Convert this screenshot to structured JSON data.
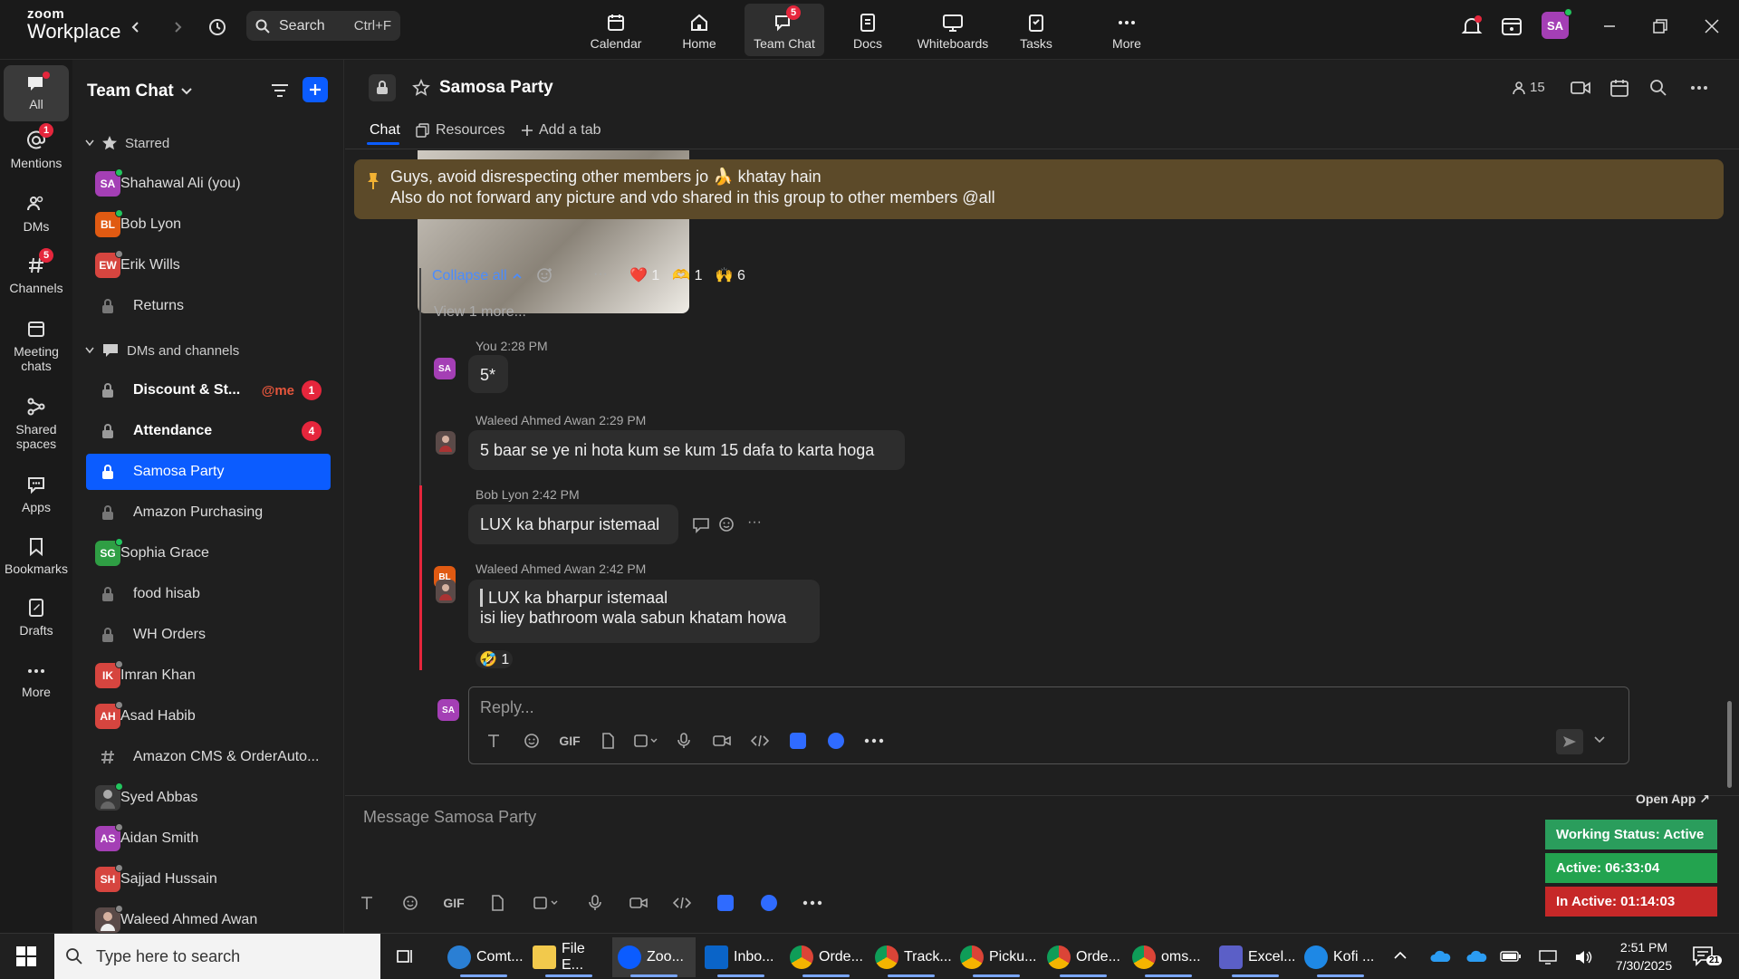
{
  "app": {
    "logo_top": "zoom",
    "logo_bottom": "Workplace"
  },
  "topbar": {
    "search_label": "Search",
    "search_shortcut": "Ctrl+F",
    "nav": [
      {
        "label": "Calendar"
      },
      {
        "label": "Home"
      },
      {
        "label": "Team Chat",
        "badge": "5"
      },
      {
        "label": "Docs"
      },
      {
        "label": "Whiteboards"
      },
      {
        "label": "Tasks"
      },
      {
        "label": "More"
      }
    ],
    "avatar": "SA"
  },
  "rail": [
    {
      "label": "All"
    },
    {
      "label": "Mentions",
      "badge": "1"
    },
    {
      "label": "DMs"
    },
    {
      "label": "Channels",
      "badge": "5"
    },
    {
      "label": "Meeting chats"
    },
    {
      "label": "Shared spaces"
    },
    {
      "label": "Apps"
    },
    {
      "label": "Bookmarks"
    },
    {
      "label": "Drafts"
    },
    {
      "label": "More"
    }
  ],
  "sidebar": {
    "title": "Team Chat",
    "starred_label": "Starred",
    "starred": [
      {
        "initials": "SA",
        "name": "Shahawal Ali (you)",
        "color": "#a43fb5"
      },
      {
        "initials": "BL",
        "name": "Bob Lyon",
        "color": "#e05a12"
      },
      {
        "initials": "EW",
        "name": "Erik Wills",
        "color": "#d6453f"
      },
      {
        "name": "Returns"
      }
    ],
    "dms_label": "DMs and channels",
    "channels": [
      {
        "name": "Discount & St...",
        "mention": "@me",
        "count": "1"
      },
      {
        "name": "Attendance",
        "count": "4"
      },
      {
        "name": "Samosa Party"
      },
      {
        "name": "Amazon Purchasing"
      },
      {
        "initials": "SG",
        "name": "Sophia Grace",
        "color": "#2f9e44"
      },
      {
        "name": "food hisab"
      },
      {
        "name": "WH Orders"
      },
      {
        "initials": "IK",
        "name": "Imran Khan",
        "color": "#d6453f"
      },
      {
        "initials": "AH",
        "name": "Asad Habib",
        "color": "#d6453f"
      },
      {
        "name": "Amazon CMS & OrderAuto..."
      },
      {
        "name": "Syed Abbas"
      },
      {
        "initials": "AS",
        "name": "Aidan Smith",
        "color": "#a43fb5"
      },
      {
        "initials": "SH",
        "name": "Sajjad Hussain",
        "color": "#d6453f"
      },
      {
        "name": "Waleed Ahmed Awan"
      }
    ]
  },
  "channel": {
    "name": "Samosa Party",
    "members": "15",
    "tabs": {
      "chat": "Chat",
      "resources": "Resources",
      "add": "Add a tab"
    },
    "pinned_line1": "Guys, avoid disrespecting other members jo 🍌 khatay hain",
    "pinned_line2": "Also do not forward any picture and vdo shared in this group to other members @all"
  },
  "thread": {
    "collapse": "Collapse all",
    "reactions": [
      {
        "emoji": "❤️",
        "count": "1"
      },
      {
        "emoji": "🫶",
        "count": "1"
      },
      {
        "emoji": "🙌",
        "count": "6"
      }
    ],
    "view_more": "View 1 more...",
    "messages": [
      {
        "author": "You",
        "time": "2:28 PM",
        "avatar": "SA",
        "text": "5*"
      },
      {
        "author": "Waleed Ahmed Awan",
        "time": "2:29 PM",
        "text": "5 baar se ye ni hota kum se kum 15 dafa to karta hoga"
      },
      {
        "author": "Bob Lyon",
        "time": "2:42 PM",
        "avatar": "BL",
        "text": "LUX ka bharpur istemaal"
      },
      {
        "author": "Waleed Ahmed Awan",
        "time": "2:42 PM",
        "quote": "LUX ka bharpur istemaal",
        "text": "isi liey bathroom wala sabun khatam howa",
        "reaction_emoji": "🤣",
        "reaction_count": "1"
      }
    ],
    "reply_placeholder": "Reply...",
    "reply_avatar": "SA"
  },
  "composer": {
    "placeholder": "Message Samosa Party",
    "gif": "GIF"
  },
  "widget": {
    "open_app": "Open App ↗",
    "working_status": "Working Status: Active",
    "active": "Active: 06:33:04",
    "inactive": "In Active: 01:14:03",
    "colors": {
      "working": "#1f9d55",
      "active": "#1e9f4a",
      "inactive": "#c62828"
    }
  },
  "taskbar": {
    "search_placeholder": "Type here to search",
    "apps": [
      {
        "label": "Comt...",
        "color": "#2a7fd4"
      },
      {
        "label": "File E...",
        "color": "#f2c94c"
      },
      {
        "label": "Zoo...",
        "color": "#0b5cff"
      },
      {
        "label": "Inbo...",
        "color": "#0a64c8"
      },
      {
        "label": "Orde...",
        "color": "#db4437"
      },
      {
        "label": "Track...",
        "color": "#db4437"
      },
      {
        "label": "Picku...",
        "color": "#db4437"
      },
      {
        "label": "Orde...",
        "color": "#db4437"
      },
      {
        "label": "oms...",
        "color": "#db4437"
      },
      {
        "label": "Excel...",
        "color": "#5b5fc7"
      },
      {
        "label": "Kofi ...",
        "color": "#1e88e5"
      }
    ],
    "time": "2:51 PM",
    "date": "7/30/2025",
    "notif_count": "21"
  }
}
